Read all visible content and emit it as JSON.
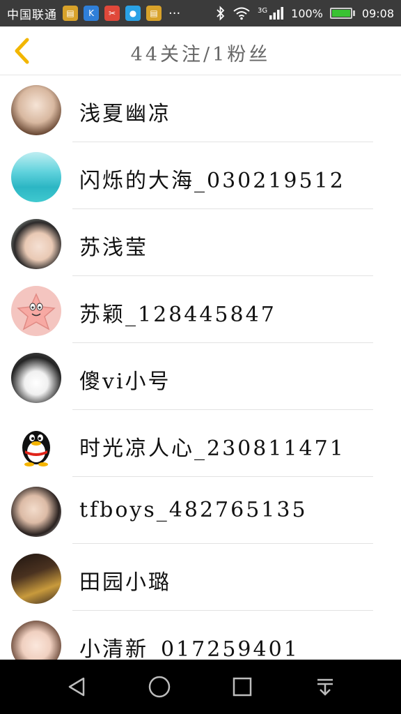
{
  "status_bar": {
    "carrier": "中国联通",
    "more": "···",
    "network": "3G",
    "battery_percent": "100%",
    "battery_level": 1.0,
    "time": "09:08"
  },
  "header": {
    "title": "44关注/1粉丝",
    "back_icon": "chevron-left-icon",
    "accent_color": "#f2b600"
  },
  "contacts": [
    {
      "name": "浅夏幽凉"
    },
    {
      "name": "闪烁的大海_030219512"
    },
    {
      "name": "苏浅莹"
    },
    {
      "name": "苏颖_128445847"
    },
    {
      "name": "傻vi小号"
    },
    {
      "name": "时光凉人心_230811471"
    },
    {
      "name": "tfboys_482765135"
    },
    {
      "name": "田园小璐"
    },
    {
      "name": "小清新_017259401"
    }
  ],
  "nav": {
    "back_icon": "triangle-back-icon",
    "home_icon": "circle-home-icon",
    "recents_icon": "square-recents-icon",
    "notification_icon": "pull-down-icon"
  }
}
